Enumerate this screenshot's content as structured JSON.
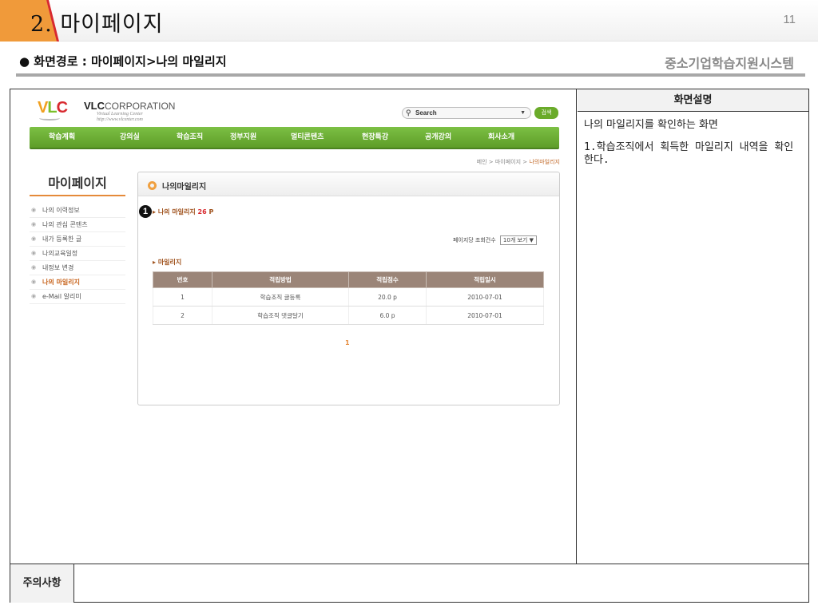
{
  "slide": {
    "title": "2. 마이페이지",
    "page_number": "11",
    "path": "● 화면경로 : 마이페이지>나의 마일리지",
    "system_name": "중소기업학습지원시스템"
  },
  "site": {
    "logo": {
      "v": "V",
      "l": "L",
      "c": "C",
      "corp_bold": "VLC",
      "corp_rest": "CORPORATION",
      "sub_line1": "Virtual Learning Center",
      "sub_line2": "http://www.vlcenter.com"
    },
    "search": {
      "placeholder": "Search",
      "button": "검색"
    },
    "nav": [
      "학습계획",
      "강의실",
      "학습조직",
      "정부지원",
      "멀티콘텐츠",
      "현장특강",
      "공개강의",
      "회사소개"
    ],
    "breadcrumb": {
      "prefix": "메인 > 마이페이지 > ",
      "current": "나의마일리지"
    },
    "sidebar": {
      "title": "마이페이지",
      "items": [
        "나의 이력정보",
        "나의 관심 콘텐츠",
        "내가 등록한 글",
        "나의교육일정",
        "내정보 변경",
        "나의 마일리지",
        "e-Mail 알리미"
      ]
    },
    "content": {
      "title": "나의마일리지",
      "badge": "1",
      "mileage_label": "나의 마일리지 ",
      "mileage_value": "26",
      "mileage_unit": " P",
      "per_page_label": "페이지당 조회건수",
      "per_page_value": "10개 보기",
      "section_title": "마일리지",
      "table": {
        "headers": [
          "번호",
          "적립방법",
          "적립점수",
          "적립일시"
        ],
        "rows": [
          [
            "1",
            "학습조직 글등록",
            "20.0 p",
            "2010-07-01"
          ],
          [
            "2",
            "학습조직 댓글달기",
            "6.0 p",
            "2010-07-01"
          ]
        ]
      },
      "pager": "1"
    }
  },
  "description": {
    "header": "화면설명",
    "summary": "나의 마일리지를 확인하는 화면",
    "point1": "1.학습조직에서 획득한 마일리지 내역을 확인한다."
  },
  "notes": {
    "label": "주의사항",
    "value": ""
  },
  "colors": {
    "nav_green": "#6aab2a",
    "accent_orange": "#e58a3a",
    "table_header": "#9b8578"
  }
}
